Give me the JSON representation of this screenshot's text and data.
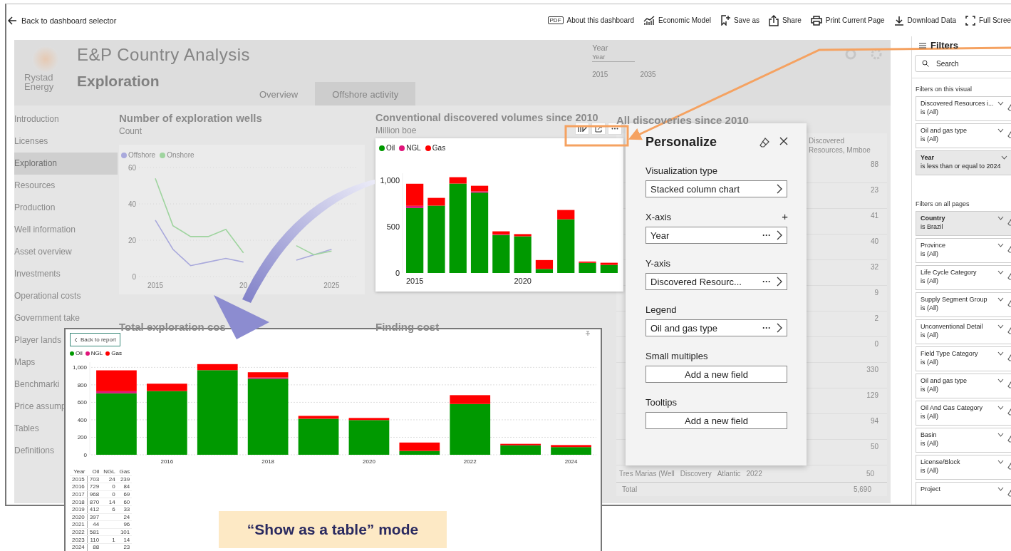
{
  "top_bar": {
    "back_label": "Back to dashboard selector",
    "actions": [
      {
        "kind": "pdf",
        "badge": "PDF",
        "label": "About this dashboard"
      },
      {
        "kind": "model",
        "label": "Economic Model"
      },
      {
        "kind": "save",
        "label": "Save as"
      },
      {
        "kind": "share",
        "label": "Share"
      },
      {
        "kind": "print",
        "label": "Print Current Page"
      },
      {
        "kind": "download",
        "label": "Download Data"
      },
      {
        "kind": "fullscreen",
        "label": "Full Scree"
      }
    ]
  },
  "report": {
    "logo_text": "Rystad Energy",
    "title": "E&P Country Analysis",
    "page_title": "Exploration",
    "tabs": [
      {
        "label": "Overview",
        "selected": false
      },
      {
        "label": "Offshore activity",
        "selected": true
      }
    ],
    "year_slicer": {
      "label": "Year",
      "dropdown": "Year",
      "start": "2015",
      "end": "2035"
    },
    "nav": [
      {
        "label": "Introduction",
        "selected": false
      },
      {
        "label": "Licenses",
        "selected": false
      },
      {
        "label": "Exploration",
        "selected": true
      },
      {
        "label": "Resources",
        "selected": false
      },
      {
        "label": "Production",
        "selected": false
      },
      {
        "label": "Well information",
        "selected": false
      },
      {
        "label": "Asset overview",
        "selected": false
      },
      {
        "label": "Investments",
        "selected": false
      },
      {
        "label": "Operational costs",
        "selected": false
      },
      {
        "label": "Government take",
        "selected": false
      },
      {
        "label": "Player lands",
        "selected": false
      },
      {
        "label": "Maps",
        "selected": false
      },
      {
        "label": "Benchmarki",
        "selected": false
      },
      {
        "label": "Price assump",
        "selected": false
      },
      {
        "label": "Tables",
        "selected": false
      },
      {
        "label": "Definitions",
        "selected": false
      }
    ],
    "wells_visual": {
      "title": "Number of exploration wells",
      "subtitle": "Count",
      "chart_data": {
        "type": "line",
        "x": [
          2015,
          2016,
          2017,
          2018,
          2019,
          2020,
          2021,
          2022,
          2023,
          2024,
          2025
        ],
        "xlim": [
          2014.07,
          2026.4
        ],
        "ylim": [
          0,
          60
        ],
        "yticks": [
          0,
          20,
          40,
          60
        ],
        "xticks": [
          2015,
          {
            "value": 2020,
            "label": "20"
          },
          2025
        ],
        "grid": true,
        "legend": "top",
        "series": [
          {
            "name": "Offshore",
            "color": "#a9a9dc",
            "values": [
              31,
              15,
              6,
              8,
              10,
              8,
              null,
              null,
              9,
              12,
              15
            ]
          },
          {
            "name": "Onshore",
            "color": "#9fd49f",
            "values": [
              54,
              28,
              22,
              22,
              26,
              13,
              null,
              null,
              17,
              12,
              14
            ]
          }
        ]
      }
    },
    "volumes_visual": {
      "title": "Conventional discovered volumes since 2010",
      "subtitle": "Million boe",
      "chart_data": {
        "type": "bar",
        "stacked": true,
        "x": [
          2015,
          2016,
          2017,
          2018,
          2019,
          2020,
          2021,
          2022,
          2023,
          2024
        ],
        "xlim": [
          2014.5,
          2024.5
        ],
        "ylim": [
          0,
          1080
        ],
        "yticks": [
          0,
          500,
          {
            "value": 1000,
            "label": "1,000"
          }
        ],
        "xticks": [
          2015,
          2020
        ],
        "legend": "top",
        "series": [
          {
            "name": "Oil",
            "color": "#009900",
            "values": [
              703,
              729,
              968,
              870,
              412,
              397,
              44,
              581,
              110,
              88
            ]
          },
          {
            "name": "NGL",
            "color": "#e0157a",
            "values": [
              24,
              0,
              0,
              14,
              6,
              null,
              null,
              null,
              null,
              null
            ]
          },
          {
            "name": "Gas",
            "color": "#ff0000",
            "values": [
              239,
              84,
              69,
              60,
              33,
              24,
              96,
              101,
              14,
              23
            ]
          }
        ]
      }
    },
    "discoveries_visual": {
      "title": "All discoveries since 2010",
      "value_header": "Discovered Resources, Mmboe",
      "values": [
        "88",
        "23",
        "41",
        "40",
        "32",
        "9",
        "2",
        "0",
        "330",
        "129",
        "94",
        "50"
      ],
      "last_row": [
        "Tres Marias (Well",
        "Discovery",
        "Atlantic",
        "2022",
        "50"
      ],
      "total_row": [
        "Total",
        "5,690"
      ]
    },
    "bottom_titles": [
      "Total exploration cos",
      "Finding cost"
    ]
  },
  "personalize": {
    "title": "Personalize",
    "sections": [
      {
        "kind": "select",
        "label": "Visualization type",
        "value": "Stacked column chart"
      },
      {
        "kind": "select",
        "label": "X-axis",
        "value": "Year",
        "more": "···",
        "add": "+"
      },
      {
        "kind": "select",
        "label": "Y-axis",
        "value": "Discovered Resourc...",
        "more": "···"
      },
      {
        "kind": "select",
        "label": "Legend",
        "value": "Oil and gas type",
        "more": "···"
      },
      {
        "kind": "add",
        "label": "Small multiples",
        "value": "Add a new field"
      },
      {
        "kind": "add",
        "label": "Tooltips",
        "value": "Add a new field"
      }
    ]
  },
  "filters": {
    "title": "Filters",
    "search_placeholder": "Search",
    "groups": [
      {
        "label": "Filters on this visual",
        "cards": [
          {
            "name": "Discovered Resources i...",
            "condition": "is (All)",
            "applied": false
          },
          {
            "name": "Oil and gas type",
            "condition": "is (All)",
            "applied": false
          },
          {
            "name": "Year",
            "condition": "is less than or equal to 2024",
            "applied": true
          }
        ]
      },
      {
        "label": "Filters on all pages",
        "cards": [
          {
            "name": "Country",
            "condition": "is Brazil",
            "applied": true
          },
          {
            "name": "Province",
            "condition": "is (All)",
            "applied": false
          },
          {
            "name": "Life Cycle Category",
            "condition": "is (All)",
            "applied": false
          },
          {
            "name": "Supply Segment Group",
            "condition": "is (All)",
            "applied": false
          },
          {
            "name": "Unconventional Detail",
            "condition": "is (All)",
            "applied": false
          },
          {
            "name": "Field Type Category",
            "condition": "is (All)",
            "applied": false
          },
          {
            "name": "Oil and gas type",
            "condition": "is (All)",
            "applied": false
          },
          {
            "name": "Oil And Gas Category",
            "condition": "is (All)",
            "applied": false
          },
          {
            "name": "Basin",
            "condition": "is (All)",
            "applied": false
          },
          {
            "name": "License/Block",
            "condition": "is (All)",
            "applied": false
          },
          {
            "name": "Project",
            "applied": false
          }
        ]
      }
    ]
  },
  "table_view": {
    "back_label": "Back to report",
    "chart_data": {
      "type": "bar",
      "stacked": true,
      "x": [
        2015,
        2016,
        2017,
        2018,
        2019,
        2020,
        2021,
        2022,
        2023,
        2024
      ],
      "xlim": [
        2014.5,
        2024.5
      ],
      "ylim": [
        0,
        1060
      ],
      "yticks": [
        0,
        200,
        400,
        600,
        800,
        {
          "value": 1000,
          "label": "1,000"
        }
      ],
      "xticks": [
        2016,
        2018,
        2020,
        2022,
        2024
      ],
      "legend": "top",
      "grid": true,
      "series": [
        {
          "name": "Oil",
          "color": "#009900",
          "values": [
            703,
            729,
            968,
            870,
            412,
            397,
            44,
            581,
            110,
            88
          ]
        },
        {
          "name": "NGL",
          "color": "#e0157a",
          "values": [
            24,
            0,
            0,
            14,
            null,
            null,
            null,
            null,
            1,
            null
          ]
        },
        {
          "name": "Gas",
          "color": "#ff0000",
          "values": [
            239,
            84,
            69,
            60,
            33,
            24,
            96,
            101,
            14,
            23
          ]
        }
      ]
    },
    "table": {
      "columns": [
        "Year",
        "Oil",
        "NGL",
        "Gas"
      ],
      "rows": [
        [
          "2015",
          "703",
          "24",
          "239"
        ],
        [
          "2016",
          "729",
          "0",
          "84"
        ],
        [
          "2017",
          "968",
          "0",
          "69"
        ],
        [
          "2018",
          "870",
          "14",
          "60"
        ],
        [
          "2019",
          "412",
          "6",
          "33"
        ],
        [
          "2020",
          "397",
          null,
          "24"
        ],
        [
          "2021",
          "44",
          null,
          "96"
        ],
        [
          "2022",
          "581",
          null,
          "101"
        ],
        [
          "2023",
          "110",
          "1",
          "14"
        ],
        [
          "2024",
          "88",
          null,
          "23"
        ]
      ]
    }
  },
  "caption": "“Show as a table” mode"
}
